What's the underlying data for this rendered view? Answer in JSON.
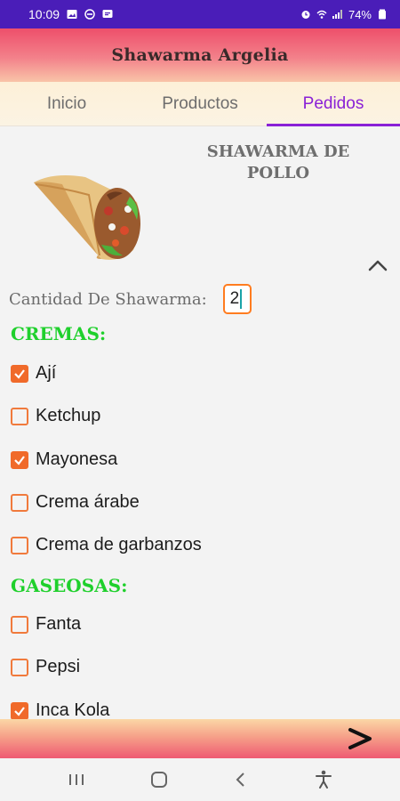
{
  "status_bar": {
    "time": "10:09",
    "battery": "74%",
    "icons": [
      "image-icon",
      "do-not-disturb-icon",
      "message-icon",
      "alarm-icon",
      "wifi-icon",
      "signal-icon",
      "battery-icon"
    ]
  },
  "header": {
    "title": "Shawarma Argelia"
  },
  "tabs": [
    {
      "label": "Inicio",
      "active": false
    },
    {
      "label": "Productos",
      "active": false
    },
    {
      "label": "Pedidos",
      "active": true
    }
  ],
  "product": {
    "title": "SHAWARMA DE POLLO",
    "quantity_label": "Cantidad De Shawarma:",
    "quantity_value": "2"
  },
  "sections": {
    "cremas": {
      "heading": "CREMAS:",
      "options": [
        {
          "label": "Ají",
          "checked": true
        },
        {
          "label": "Ketchup",
          "checked": false
        },
        {
          "label": "Mayonesa",
          "checked": true
        },
        {
          "label": "Crema árabe",
          "checked": false
        },
        {
          "label": "Crema de garbanzos",
          "checked": false
        }
      ]
    },
    "gaseosas": {
      "heading": "GASEOSAS:",
      "options": [
        {
          "label": "Fanta",
          "checked": false
        },
        {
          "label": "Pepsi",
          "checked": false
        },
        {
          "label": "Inca Kola",
          "checked": true
        }
      ]
    }
  },
  "colors": {
    "accent": "#8a21d6",
    "checkbox": "#f06a2a",
    "section_heading": "#1fd02c",
    "status_bar": "#4a1db8"
  },
  "nav_icons": [
    "recent-apps-icon",
    "home-icon",
    "back-icon",
    "accessibility-icon"
  ]
}
